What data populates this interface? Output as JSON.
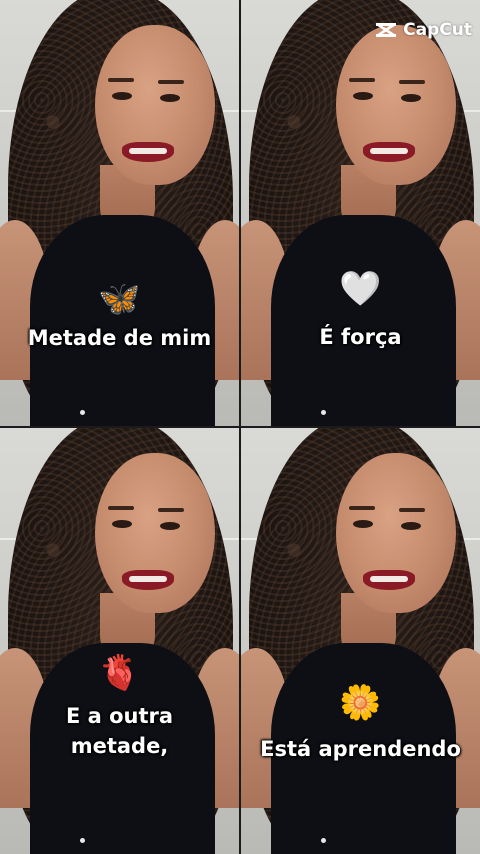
{
  "watermark": {
    "text": "CapCut",
    "icon": "capcut-logo-icon"
  },
  "panels": [
    {
      "emoji": "🦋",
      "emoji_name": "butterfly-icon",
      "caption": "Metade de mim"
    },
    {
      "emoji": "🤍",
      "emoji_name": "white-heart-icon",
      "caption": "É força"
    },
    {
      "emoji": "🫀",
      "emoji_name": "anatomical-heart-icon",
      "caption": "E a outra\nmetade,"
    },
    {
      "emoji": "🌼",
      "emoji_name": "daisy-flower-icon",
      "caption": "Está aprendendo"
    }
  ],
  "colors": {
    "caption_text": "#ffffff",
    "background": "#1b1b1d",
    "lipstick": "#8a1a25"
  }
}
